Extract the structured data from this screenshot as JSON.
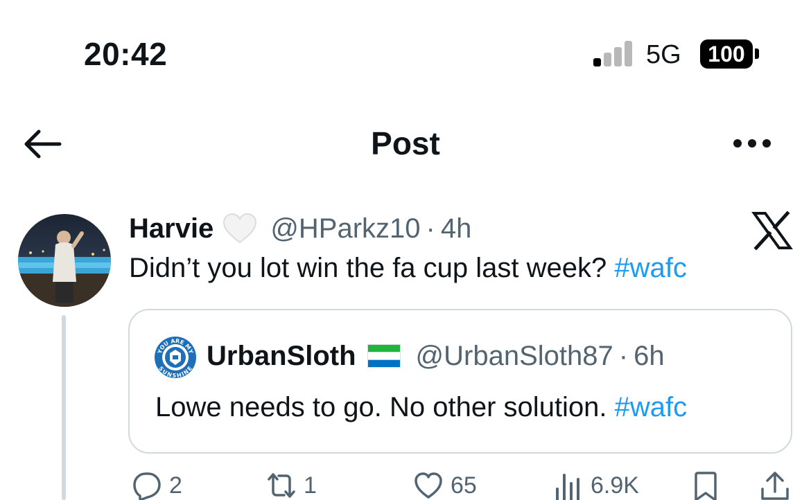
{
  "status_bar": {
    "time": "20:42",
    "network": "5G",
    "battery": "100",
    "icons": [
      "cellular-signal-icon",
      "battery-icon"
    ]
  },
  "header": {
    "title": "Post",
    "icons": [
      "back-arrow-icon",
      "more-options-icon"
    ]
  },
  "post": {
    "display_name": "Harvie",
    "badge_icon": "white-heart-icon",
    "handle": "@HParkz10",
    "separator": "·",
    "time": "4h",
    "text": "Didn’t you lot win the fa cup last week?",
    "hashtag": "#wafc",
    "source_icon": "x-logo-icon"
  },
  "quote": {
    "display_name": "UrbanSloth",
    "flag_icon": "sierra-leone-flag-icon",
    "handle": "@UrbanSloth87",
    "separator": "·",
    "time": "6h",
    "text": "Lowe needs to go. No other solution.",
    "hashtag": "#wafc",
    "avatar_text_top": "YOU ARE MY",
    "avatar_text_bottom": "SUNSHINE"
  },
  "actions": {
    "replies": "2",
    "reposts": "1",
    "likes": "65",
    "views": "6.9K",
    "icons": [
      "reply-icon",
      "repost-icon",
      "like-icon",
      "views-icon",
      "bookmark-icon",
      "share-icon"
    ]
  },
  "colors": {
    "accent": "#1d9bf0",
    "secondary_text": "#536471",
    "border": "#cfd9de",
    "text": "#0f1419"
  }
}
